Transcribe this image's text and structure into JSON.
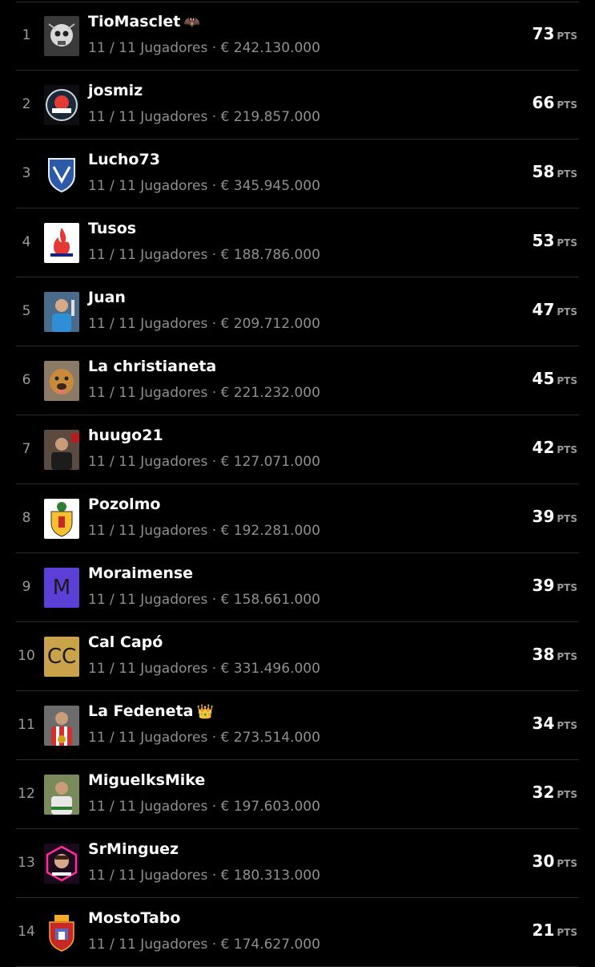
{
  "points_unit": "PTS",
  "rows": [
    {
      "rank": "1",
      "name": "TioMasclet",
      "badge": "🦇",
      "players": "11 / 11 Jugadores",
      "value": "€ 242.130.000",
      "points": "73",
      "avatar": "skull-logo-icon"
    },
    {
      "rank": "2",
      "name": "josmiz",
      "badge": "",
      "players": "11 / 11 Jugadores",
      "value": "€ 219.857.000",
      "points": "66",
      "avatar": "team-crest-icon"
    },
    {
      "rank": "3",
      "name": "Lucho73",
      "badge": "",
      "players": "11 / 11 Jugadores",
      "value": "€ 345.945.000",
      "points": "58",
      "avatar": "blue-shield-crest-icon"
    },
    {
      "rank": "4",
      "name": "Tusos",
      "badge": "",
      "players": "11 / 11 Jugadores",
      "value": "€ 188.786.000",
      "points": "53",
      "avatar": "flame-logo-icon"
    },
    {
      "rank": "5",
      "name": "Juan",
      "badge": "",
      "players": "11 / 11 Jugadores",
      "value": "€ 209.712.000",
      "points": "47",
      "avatar": "user-photo"
    },
    {
      "rank": "6",
      "name": "La christianeta",
      "badge": "",
      "players": "11 / 11 Jugadores",
      "value": "€ 221.232.000",
      "points": "45",
      "avatar": "dog-photo"
    },
    {
      "rank": "7",
      "name": "huugo21",
      "badge": "",
      "players": "11 / 11 Jugadores",
      "value": "€ 127.071.000",
      "points": "42",
      "avatar": "user-photo"
    },
    {
      "rank": "8",
      "name": "Pozolmo",
      "badge": "",
      "players": "11 / 11 Jugadores",
      "value": "€ 192.281.000",
      "points": "39",
      "avatar": "coat-of-arms-icon"
    },
    {
      "rank": "9",
      "name": "Moraimense",
      "badge": "",
      "players": "11 / 11 Jugadores",
      "value": "€ 158.661.000",
      "points": "39",
      "avatar": "letter-avatar",
      "initials": "M",
      "bg": "#5b3fd6",
      "fg": "#1a1a1a"
    },
    {
      "rank": "10",
      "name": "Cal Capó",
      "badge": "",
      "players": "11 / 11 Jugadores",
      "value": "€ 331.496.000",
      "points": "38",
      "avatar": "letter-avatar",
      "initials": "CC",
      "bg": "#c9a24a",
      "fg": "#1a1a1a"
    },
    {
      "rank": "11",
      "name": "La Fedeneta",
      "badge": "👑",
      "players": "11 / 11 Jugadores",
      "value": "€ 273.514.000",
      "points": "34",
      "avatar": "user-photo"
    },
    {
      "rank": "12",
      "name": "MiguelksMike",
      "badge": "",
      "players": "11 / 11 Jugadores",
      "value": "€ 197.603.000",
      "points": "32",
      "avatar": "user-photo"
    },
    {
      "rank": "13",
      "name": "SrMinguez",
      "badge": "",
      "players": "11 / 11 Jugadores",
      "value": "€ 180.313.000",
      "points": "30",
      "avatar": "neon-avatar-icon"
    },
    {
      "rank": "14",
      "name": "MostoTabo",
      "badge": "",
      "players": "11 / 11 Jugadores",
      "value": "€ 174.627.000",
      "points": "21",
      "avatar": "town-crest-icon"
    }
  ]
}
